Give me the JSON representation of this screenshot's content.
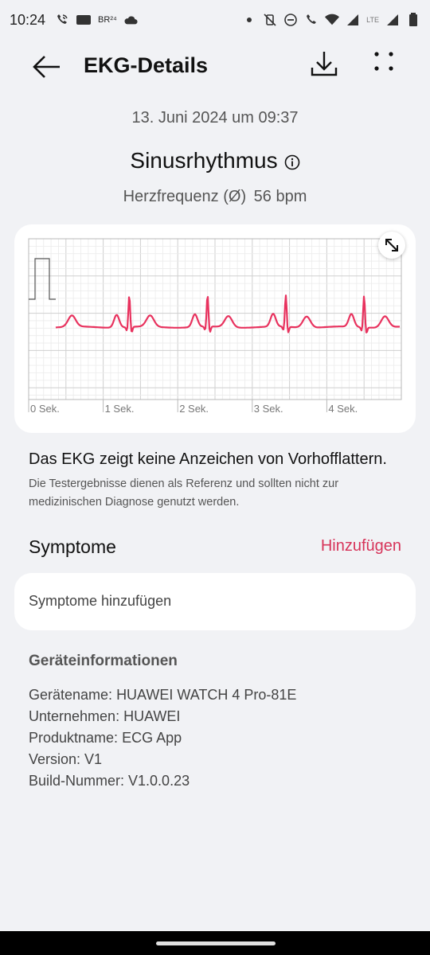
{
  "status_bar": {
    "time": "10:24",
    "left_icons": [
      "wifi-call-icon",
      "ge-icon",
      "br24-icon",
      "cloud-icon"
    ],
    "ge_label": "GE",
    "br_label": "BR²⁴",
    "right_icons": [
      "dot-icon",
      "vibrate-off-icon",
      "dnd-icon",
      "call-wifi-icon",
      "wifi-icon",
      "signal-icon",
      "lte-signal-icon",
      "battery-icon"
    ],
    "lte_label": "LTE"
  },
  "app_bar": {
    "title": "EKG-Details",
    "back_icon": "arrow-left-icon",
    "download_icon": "download-icon",
    "more_icon": "more-dots-icon"
  },
  "date": "13. Juni 2024 um 09:37",
  "rhythm": "Sinusrhythmus",
  "heart_rate": {
    "label": "Herzfrequenz (Ø)",
    "value": "56 bpm"
  },
  "verdict": "Das EKG zeigt keine Anzeichen von Vorhofflattern.",
  "disclaimer": "Die Testergebnisse dienen als Referenz und sollten nicht zur medizinischen Diagnose genutzt werden.",
  "symptoms": {
    "title": "Symptome",
    "add_link": "Hinzufügen",
    "card_text": "Symptome hinzufügen"
  },
  "device_info": {
    "title": "Geräteinformationen",
    "rows": [
      {
        "label": "Gerätename:",
        "value": "HUAWEI WATCH 4 Pro-81E"
      },
      {
        "label": "Unternehmen:",
        "value": "HUAWEI"
      },
      {
        "label": "Produktname:",
        "value": "ECG App"
      },
      {
        "label": "Version:",
        "value": "V1"
      },
      {
        "label": "Build-Nummer:",
        "value": "V1.0.0.23"
      }
    ]
  },
  "colors": {
    "accent": "#d7345a",
    "trace": "#e8325e",
    "background": "#f1f2f5"
  },
  "chart_data": {
    "type": "line",
    "x_ticks": [
      "0 Sek.",
      "1 Sek.",
      "2 Sek.",
      "3 Sek.",
      "4 Sek."
    ],
    "xlim": [
      0,
      5
    ],
    "grid": true,
    "calibration_pulse": true,
    "r_peaks_sec": [
      1.35,
      2.4,
      3.45,
      4.5
    ]
  }
}
